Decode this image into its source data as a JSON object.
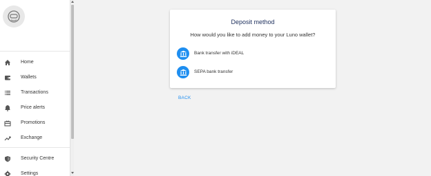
{
  "sidebar": {
    "avatar_icon": "astronaut-helmet-icon",
    "items": [
      {
        "label": "Home",
        "icon": "home-icon"
      },
      {
        "label": "Wallets",
        "icon": "wallet-icon"
      },
      {
        "label": "Transactions",
        "icon": "list-icon"
      },
      {
        "label": "Price alerts",
        "icon": "bell-icon"
      },
      {
        "label": "Promotions",
        "icon": "gift-icon"
      },
      {
        "label": "Exchange",
        "icon": "trending-up-icon"
      },
      {
        "label": "Security Centre",
        "icon": "shield-icon"
      },
      {
        "label": "Settings",
        "icon": "gear-icon"
      }
    ]
  },
  "card": {
    "title": "Deposit method",
    "subtitle": "How would you like to add money to your Luno wallet?",
    "options": [
      {
        "label": "Bank transfer with iDEAL",
        "icon": "bank-icon"
      },
      {
        "label": "SEPA bank transfer",
        "icon": "bank-icon"
      }
    ]
  },
  "back_label": "BACK",
  "colors": {
    "accent": "#1e8ef0",
    "title": "#1c2e5c",
    "background": "#f2f2f2"
  }
}
